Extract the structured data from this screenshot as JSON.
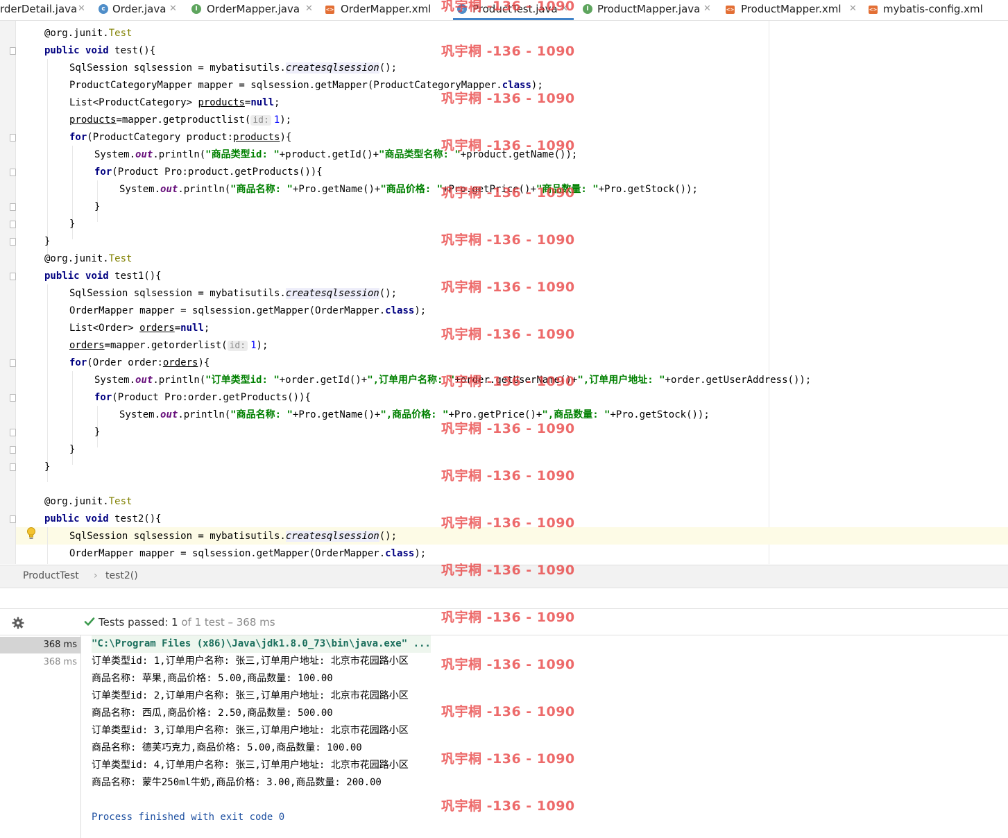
{
  "tabs": [
    {
      "label": "rderDetail.java",
      "icon": "class-icon",
      "active": false
    },
    {
      "label": "Order.java",
      "icon": "class-icon",
      "active": false
    },
    {
      "label": "OrderMapper.java",
      "icon": "interface-icon",
      "active": false
    },
    {
      "label": "OrderMapper.xml",
      "icon": "xml-icon",
      "active": false
    },
    {
      "label": "ProductTest.java",
      "icon": "class-icon",
      "active": true
    },
    {
      "label": "ProductMapper.java",
      "icon": "interface-icon",
      "active": false
    },
    {
      "label": "ProductMapper.xml",
      "icon": "xml-icon",
      "active": false
    },
    {
      "label": "mybatis-config.xml",
      "icon": "xml-icon",
      "active": false
    }
  ],
  "code": {
    "test_annotation_at": "@org.junit.",
    "test_annotation_name": "Test",
    "public": "public",
    "void": "void",
    "m_test": " test(){",
    "m_test1": " test1(){",
    "m_test2": " test2(){",
    "session_decl": "SqlSession sqlsession = mybatisutils.",
    "create_session": "createsqlsession",
    "call_end": "();",
    "pc_mapper_decl": "ProductCategoryMapper mapper = sqlsession.getMapper(ProductCategoryMapper.",
    "class_kw": "class",
    "paren_end": ");",
    "list_pc": "List<ProductCategory> ",
    "products_var": "products",
    "assign": "=",
    "null_kw": "null",
    "semi": ";",
    "getproductlist": "=mapper.getproductlist(",
    "hint_id": "id:",
    "arg_1": "1",
    "for_kw": "for",
    "for_pc": "(ProductCategory product:",
    "brace_open": "){",
    "sys": "System.",
    "out": "out",
    "println": ".println(",
    "s_pc_id": "\"商品类型id: \"",
    "p_getid": "+product.getId()+",
    "s_pc_name": "\"商品类型名称: \"",
    "p_getname_end": "+product.getName());",
    "for_prod": "(Product Pro:product.getProducts()){",
    "s_p_name": "\"商品名称: \"",
    "pro_getname": "+Pro.getName()+",
    "s_p_price": "\"商品价格: \"",
    "pro_getprice": "+Pro.getPrice()+",
    "s_p_stock": "\"商品数量: \"",
    "pro_getstock_end": "+Pro.getStock());",
    "close_brace": "}",
    "order_mapper_decl": "OrderMapper mapper = sqlsession.getMapper(OrderMapper.",
    "list_order": "List<Order> ",
    "orders_var": "orders",
    "getorderlist": "=mapper.getorderlist(",
    "for_order": "(Order order:",
    "s_o_id": "\"订单类型id: \"",
    "o_getid": "+order.getId()+",
    "s_o_user": "\",订单用户名称: \"",
    "o_getusername": "+order.getUserName()+",
    "s_o_addr": "\",订单用户地址: \"",
    "o_getaddr_end": "+order.getUserAddress());",
    "for_oprod": "(Product Pro:order.getProducts()){",
    "s_p_price2": "\",商品价格: \"",
    "s_p_stock2": "\",商品数量: \""
  },
  "breadcrumb": {
    "cls": "ProductTest",
    "sep": "›",
    "method": "test2()"
  },
  "run": {
    "status_label": "Tests passed: ",
    "status_count": "1",
    "status_rest": " of 1 test – 368 ms",
    "tree": [
      "368 ms",
      "368 ms"
    ],
    "console": [
      "\"C:\\Program Files (x86)\\Java\\jdk1.8.0_73\\bin\\java.exe\" ...",
      "订单类型id: 1,订单用户名称: 张三,订单用户地址: 北京市花园路小区",
      "商品名称: 苹果,商品价格: 5.00,商品数量: 100.00",
      "订单类型id: 2,订单用户名称: 张三,订单用户地址: 北京市花园路小区",
      "商品名称: 西瓜,商品价格: 2.50,商品数量: 500.00",
      "订单类型id: 3,订单用户名称: 张三,订单用户地址: 北京市花园路小区",
      "商品名称: 德芙巧克力,商品价格: 5.00,商品数量: 100.00",
      "订单类型id: 4,订单用户名称: 张三,订单用户地址: 北京市花园路小区",
      "商品名称: 蒙牛250ml牛奶,商品价格: 3.00,商品数量: 200.00",
      "",
      "Process finished with exit code 0"
    ]
  },
  "watermark": "巩宇桐 -136 - 1090",
  "colors": {
    "accent": "#4083c9",
    "string": "#008000",
    "keyword": "#000080",
    "pass": "#3c9a4e"
  }
}
